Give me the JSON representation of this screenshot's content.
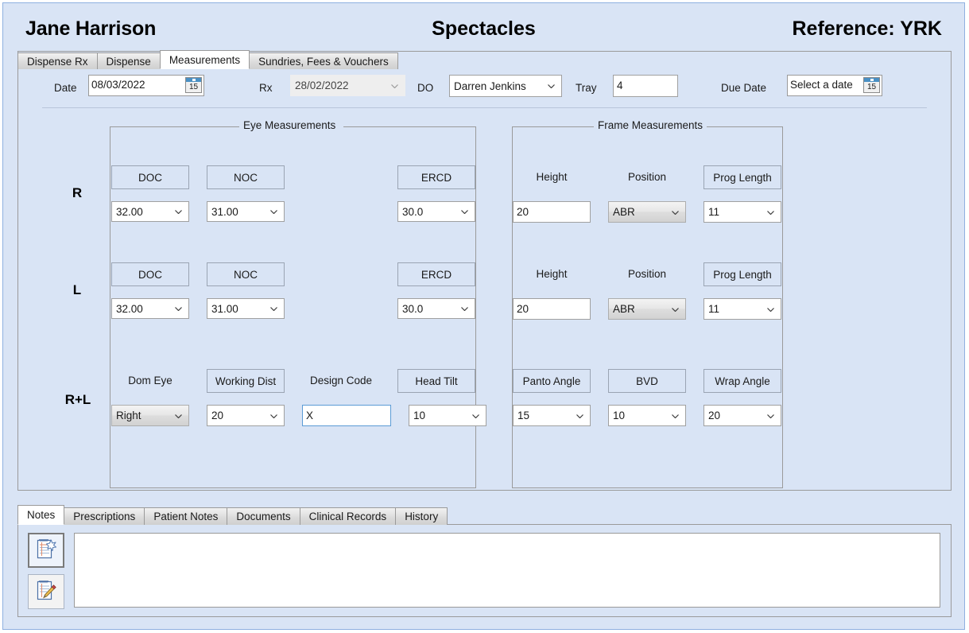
{
  "header": {
    "patient_name": "Jane Harrison",
    "title": "Spectacles",
    "reference": "Reference: YRK"
  },
  "top_tabs": [
    {
      "label": "Dispense Rx",
      "active": false
    },
    {
      "label": "Dispense",
      "active": false
    },
    {
      "label": "Measurements",
      "active": true
    },
    {
      "label": "Sundries, Fees & Vouchers",
      "active": false
    }
  ],
  "toolbar": {
    "date_label": "Date",
    "date_value": "08/03/2022",
    "date_icon_day": "15",
    "rx_label": "Rx",
    "rx_value": "28/02/2022",
    "do_label": "DO",
    "do_value": "Darren Jenkins",
    "tray_label": "Tray",
    "tray_value": "4",
    "due_date_label": "Due Date",
    "due_date_value": "Select a date",
    "due_date_icon_day": "15"
  },
  "groups": {
    "eye": "Eye Measurements",
    "frame": "Frame Measurements"
  },
  "rows": {
    "r_label": "R",
    "l_label": "L",
    "rl_label": "R+L"
  },
  "eye_headers": {
    "doc": "DOC",
    "noc": "NOC",
    "ercd": "ERCD"
  },
  "frame_headers": {
    "height": "Height",
    "position": "Position",
    "prog_length": "Prog Length"
  },
  "rl_headers": {
    "dom_eye": "Dom Eye",
    "working_dist": "Working Dist",
    "design_code": "Design Code",
    "head_tilt": "Head Tilt",
    "panto_angle": "Panto Angle",
    "bvd": "BVD",
    "wrap_angle": "Wrap Angle"
  },
  "values": {
    "r": {
      "doc": "32.00",
      "noc": "31.00",
      "ercd": "30.0",
      "height": "20",
      "position": "ABR",
      "prog_length": "11"
    },
    "l": {
      "doc": "32.00",
      "noc": "31.00",
      "ercd": "30.0",
      "height": "20",
      "position": "ABR",
      "prog_length": "11"
    },
    "rl": {
      "dom_eye": "Right",
      "working_dist": "20",
      "design_code": "X",
      "head_tilt": "10",
      "panto_angle": "15",
      "bvd": "10",
      "wrap_angle": "20"
    }
  },
  "bottom_tabs": [
    {
      "label": "Notes",
      "active": true
    },
    {
      "label": "Prescriptions",
      "active": false
    },
    {
      "label": "Patient Notes",
      "active": false
    },
    {
      "label": "Documents",
      "active": false
    },
    {
      "label": "Clinical Records",
      "active": false
    },
    {
      "label": "History",
      "active": false
    }
  ],
  "notes": {
    "new_note_icon": "new-note-icon",
    "edit_note_icon": "edit-note-icon",
    "text": ""
  },
  "colors": {
    "window_background": "#d9e4f5",
    "window_border": "#8fb0e0",
    "panel_border": "#9a9a9a",
    "focus_border": "#5b9bd5",
    "calendar_blue": "#4a90c4"
  }
}
